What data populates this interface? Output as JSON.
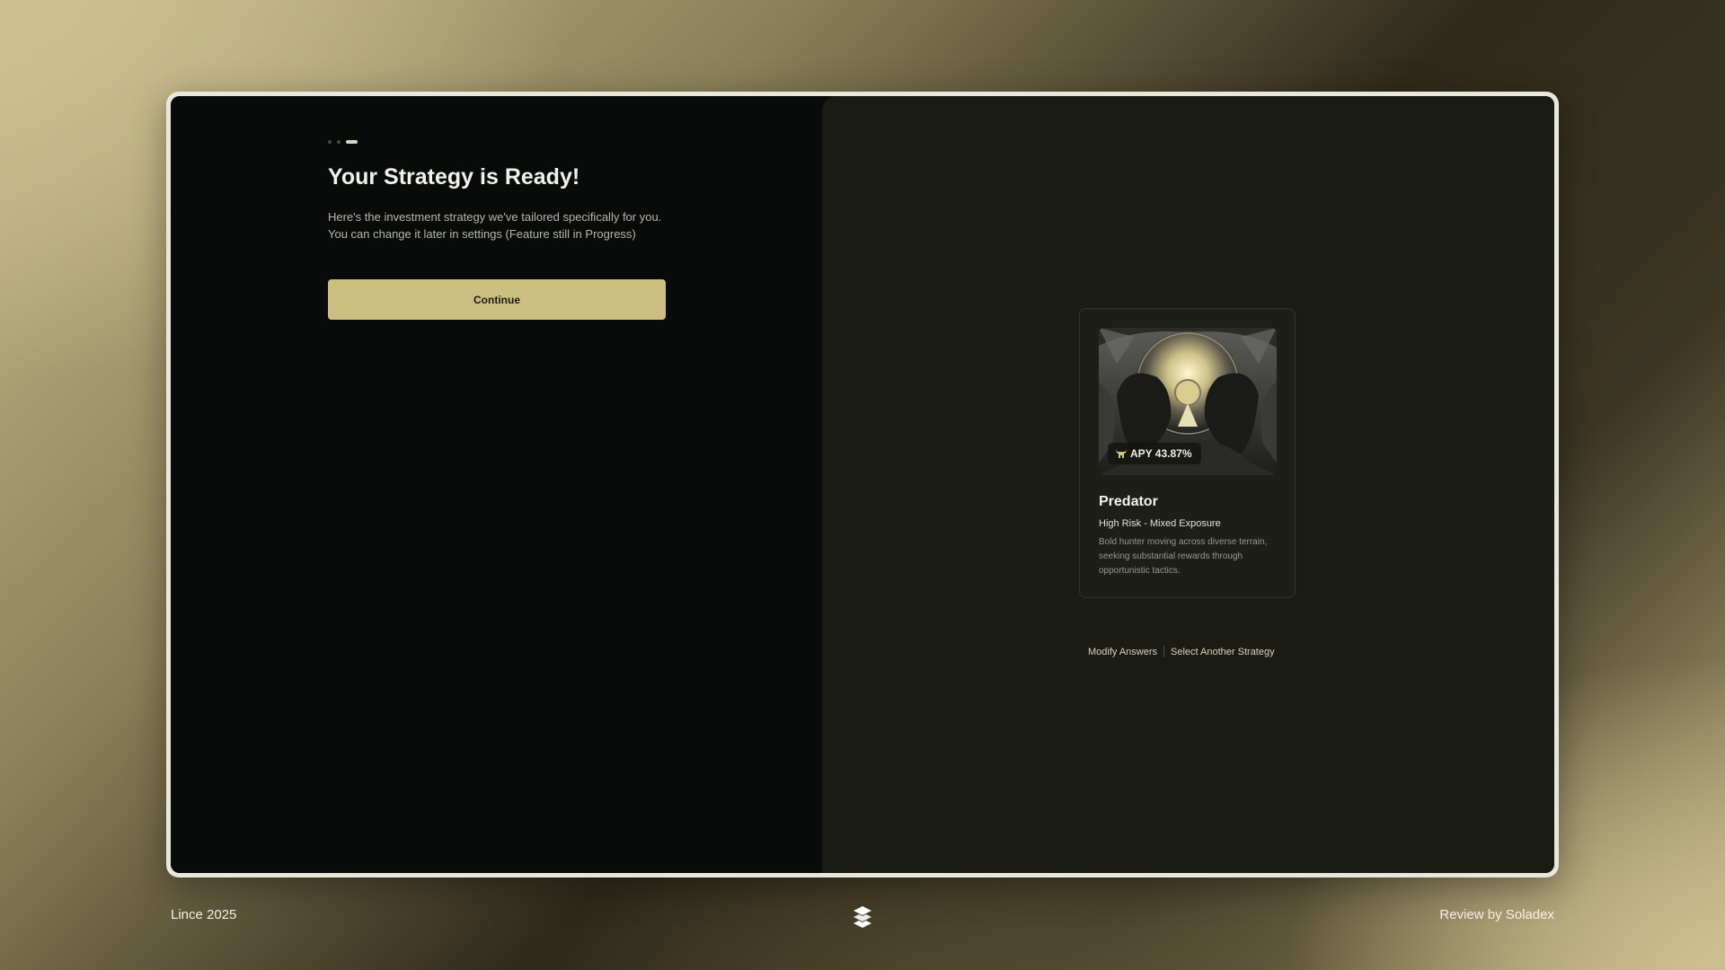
{
  "onboarding": {
    "title": "Your Strategy is Ready!",
    "description": "Here's the investment strategy we've tailored specifically for you. You can change it later in settings (Feature still in Progress)",
    "continue_label": "Continue",
    "step_count": 3,
    "active_step": 3
  },
  "strategy_card": {
    "apy_label": "APY 43.87%",
    "name": "Predator",
    "risk": "High Risk - Mixed Exposure",
    "description": "Bold hunter moving across diverse terrain, seeking substantial rewards through opportunistic tactics.",
    "image_icon": "eagles-sun-illustration",
    "badge_icon": "bull-icon"
  },
  "actions": {
    "modify_answers": "Modify Answers",
    "select_another": "Select Another Strategy"
  },
  "footer": {
    "left_text": "Lince 2025",
    "right_text": "Review by Soladex",
    "logo_icon": "stacked-chevrons-logo"
  },
  "colors": {
    "accent": "#cdbe82",
    "panel_left": "#090b0a",
    "panel_right": "#1b1b15",
    "text_primary": "#f2f0ea"
  }
}
